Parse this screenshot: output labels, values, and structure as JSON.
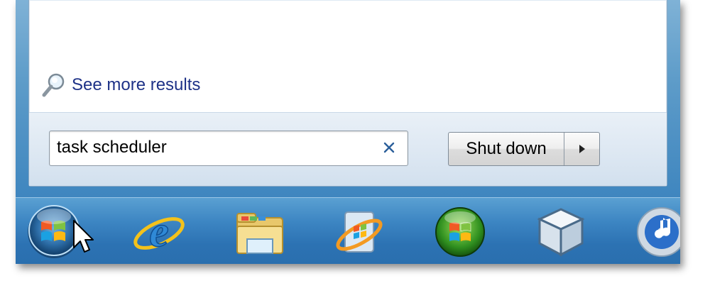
{
  "start_menu": {
    "see_more_label": "See more results",
    "search": {
      "value": "task scheduler",
      "placeholder": ""
    },
    "shutdown": {
      "label": "Shut down"
    }
  },
  "taskbar": {
    "icons": [
      {
        "name": "start-orb-icon"
      },
      {
        "name": "internet-explorer-icon"
      },
      {
        "name": "file-explorer-icon"
      },
      {
        "name": "windows-media-player-icon"
      },
      {
        "name": "windows-media-center-icon"
      },
      {
        "name": "virtualbox-icon"
      },
      {
        "name": "itunes-icon"
      }
    ]
  },
  "colors": {
    "link": "#1e3287",
    "taskbar": "#2c72b3",
    "aero": "#5e9cc9"
  }
}
